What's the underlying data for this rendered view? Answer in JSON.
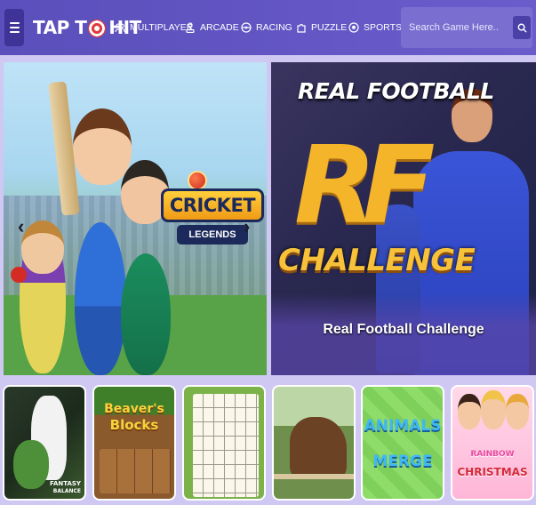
{
  "header": {
    "menu_icon": "hamburger-icon",
    "logo": {
      "part1": "TAP T",
      "part2": "HIT"
    },
    "nav": [
      {
        "label": "MULTIPLAYER",
        "icon": "multiplayer-icon"
      },
      {
        "label": "ARCADE",
        "icon": "joystick-icon"
      },
      {
        "label": "RACING",
        "icon": "steering-wheel-icon"
      },
      {
        "label": "PUZZLE",
        "icon": "puzzle-icon"
      },
      {
        "label": "SPORTS",
        "icon": "soccer-ball-icon"
      }
    ],
    "search": {
      "placeholder": "Search Game Here..",
      "icon": "search-icon"
    }
  },
  "banners": {
    "left": {
      "title": "CRICKET",
      "subtitle": "LEGENDS",
      "prev": "‹",
      "next": "›"
    },
    "right": {
      "top": "REAL FOOTBALL",
      "mark": "RF",
      "challenge": "CHALLENGE",
      "caption": "Real Football Challenge"
    }
  },
  "games": [
    {
      "title": "FANTASY",
      "sub": "BALANCE"
    },
    {
      "title": "Beaver's",
      "sub": "Blocks"
    },
    {
      "title": "",
      "sub": ""
    },
    {
      "title": "",
      "sub": ""
    },
    {
      "title": "ANIMALS",
      "sub": "MERGE"
    },
    {
      "title": "RAINBOW",
      "sub": "CHRISTMAS"
    }
  ],
  "colors": {
    "header": "#5a4fbb",
    "accent": "#3f3398",
    "search_bg": "#7a6fd0"
  }
}
